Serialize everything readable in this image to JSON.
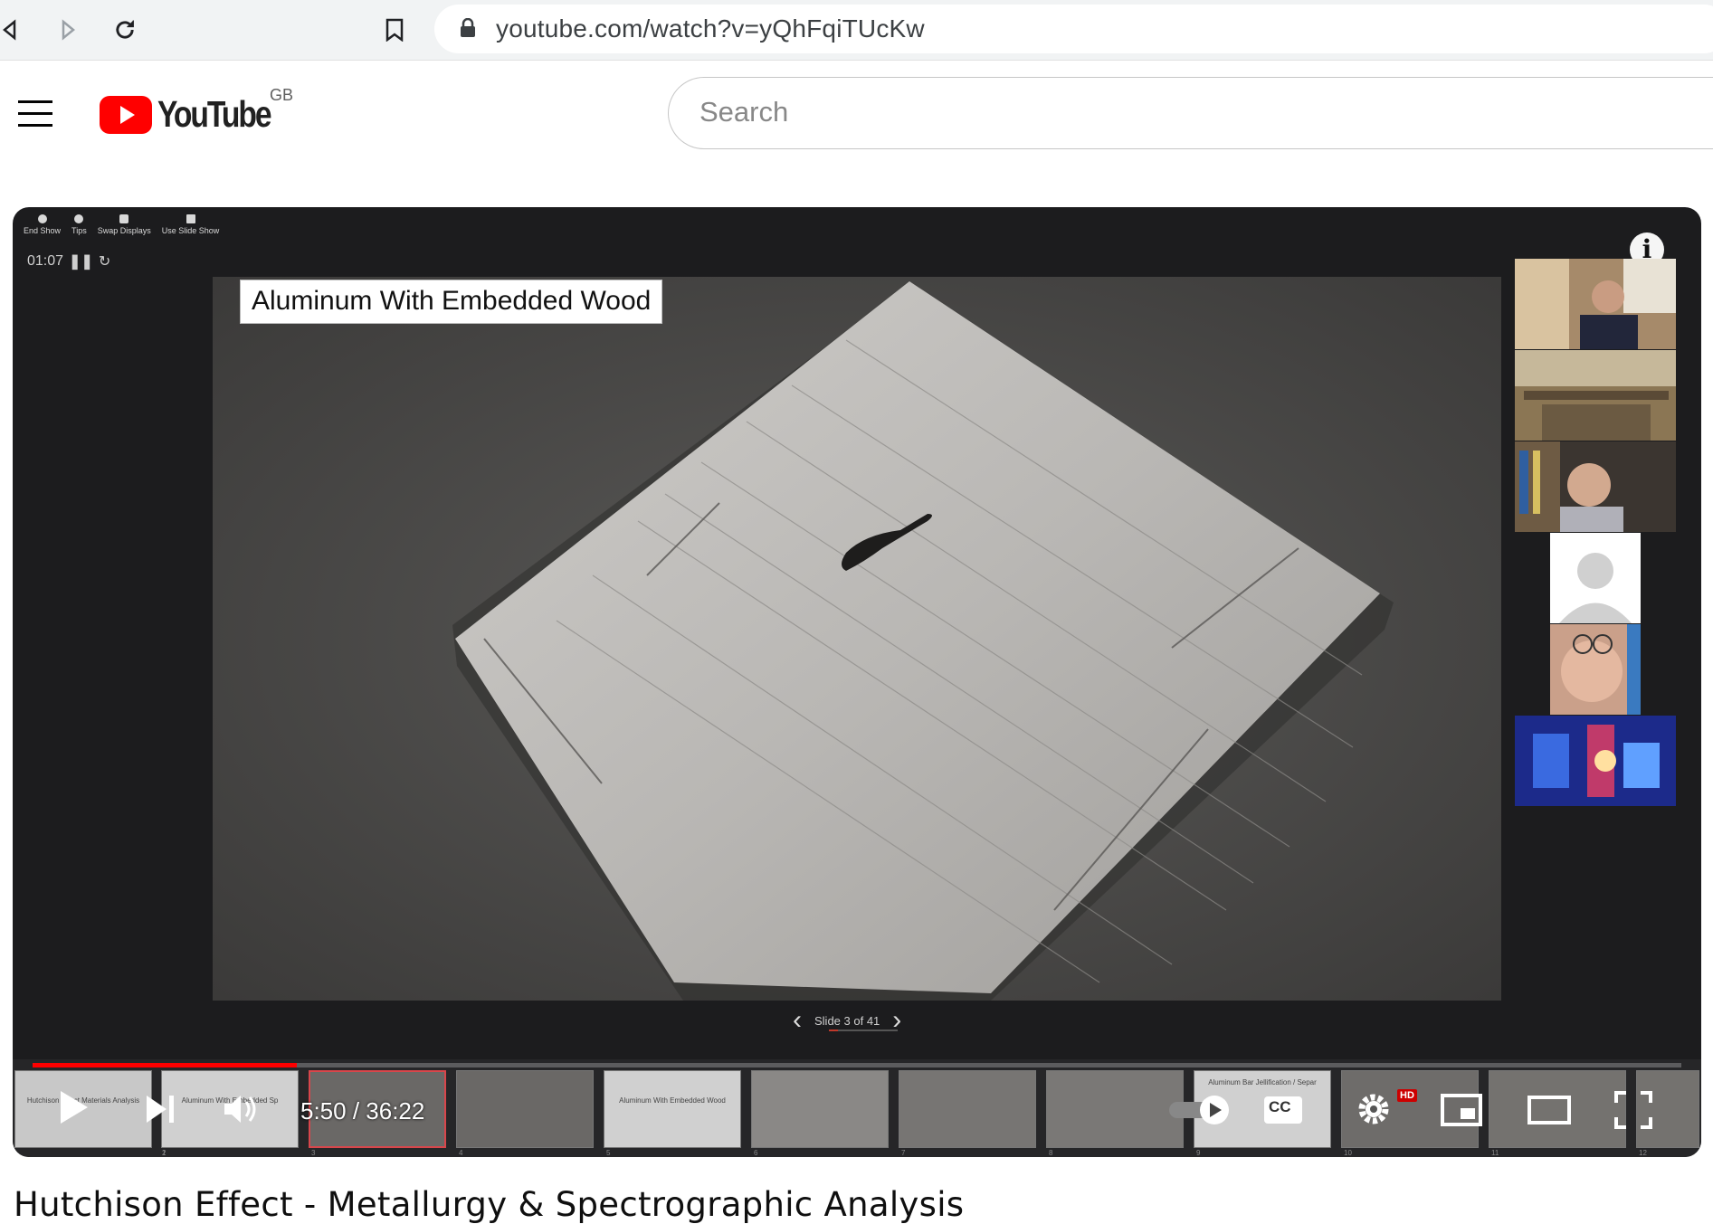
{
  "browser": {
    "url": "youtube.com/watch?v=yQhFqiTUcKw"
  },
  "header": {
    "logo_text": "YouTube",
    "region": "GB",
    "search_placeholder": "Search"
  },
  "presentation": {
    "toolbar": [
      "End Show",
      "Tips",
      "Swap Displays",
      "Use Slide Show"
    ],
    "timer": "01:07",
    "slide_title": "Aluminum With Embedded Wood",
    "slide_counter": "Slide 3 of 41"
  },
  "thumbnails": [
    {
      "num": "1",
      "caption": "Hutchison Effect Materials Analysis"
    },
    {
      "num": "2",
      "caption": "Aluminum With Embedded Sp"
    },
    {
      "num": "3",
      "caption": ""
    },
    {
      "num": "4",
      "caption": ""
    },
    {
      "num": "5",
      "caption": "Aluminum With Embedded Wood"
    },
    {
      "num": "6",
      "caption": ""
    },
    {
      "num": "7",
      "caption": ""
    },
    {
      "num": "8",
      "caption": ""
    },
    {
      "num": "9",
      "caption": "Aluminum Bar Jellification / Separ"
    },
    {
      "num": "10",
      "caption": ""
    },
    {
      "num": "11",
      "caption": ""
    },
    {
      "num": "12",
      "caption": ""
    }
  ],
  "player": {
    "time_display": "5:50 / 36:22",
    "progress_fraction": 0.16,
    "hd_badge": "HD",
    "cc_label": "CC",
    "info_label": "i"
  },
  "video": {
    "title": "Hutchison Effect - Metallurgy & Spectrographic Analysis"
  },
  "colors": {
    "brand_red": "#ff0000",
    "player_bg": "#1c1c1e"
  }
}
